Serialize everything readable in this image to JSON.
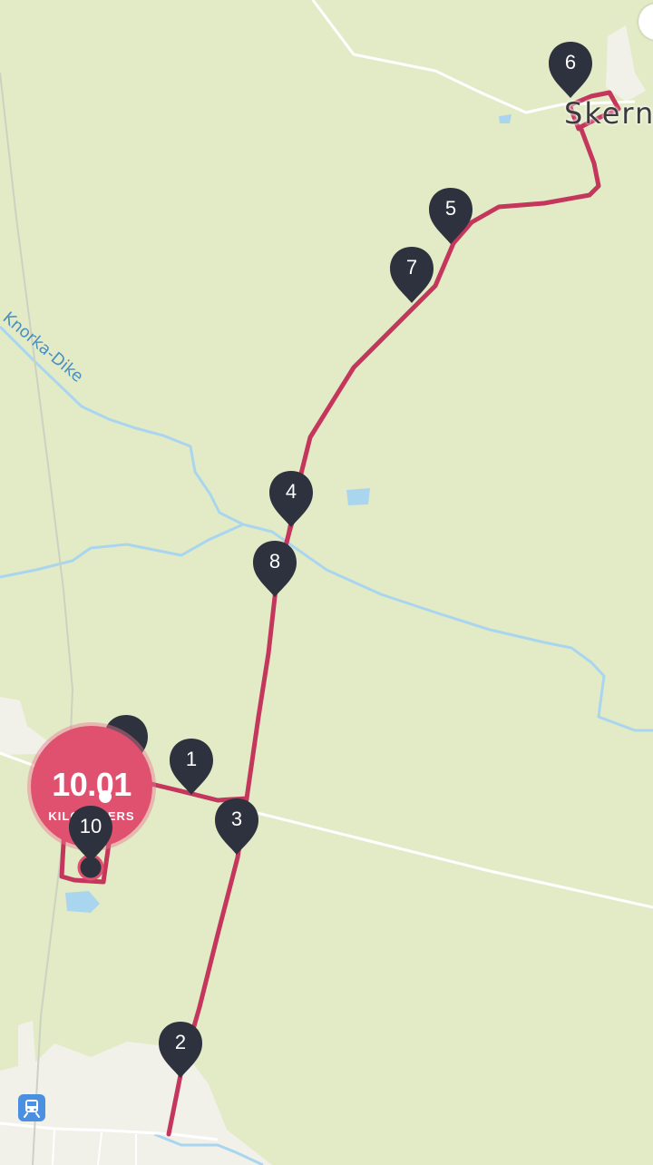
{
  "map": {
    "town_label": "Skern",
    "waterway_label": "Knorka-Dike",
    "colors": {
      "land": "#e3ebc6",
      "settlement": "#f1f1ea",
      "water": "#a9d5ef",
      "route": "#c5365c",
      "pin": "#2d323e"
    }
  },
  "route": {
    "distance_value": "10.01",
    "distance_unit": "KILOMETERS",
    "markers": [
      "1",
      "2",
      "3",
      "4",
      "5",
      "6",
      "7",
      "8",
      "10"
    ]
  },
  "icons": {
    "rail": "train-station-icon",
    "pin": "map-pin-icon"
  }
}
